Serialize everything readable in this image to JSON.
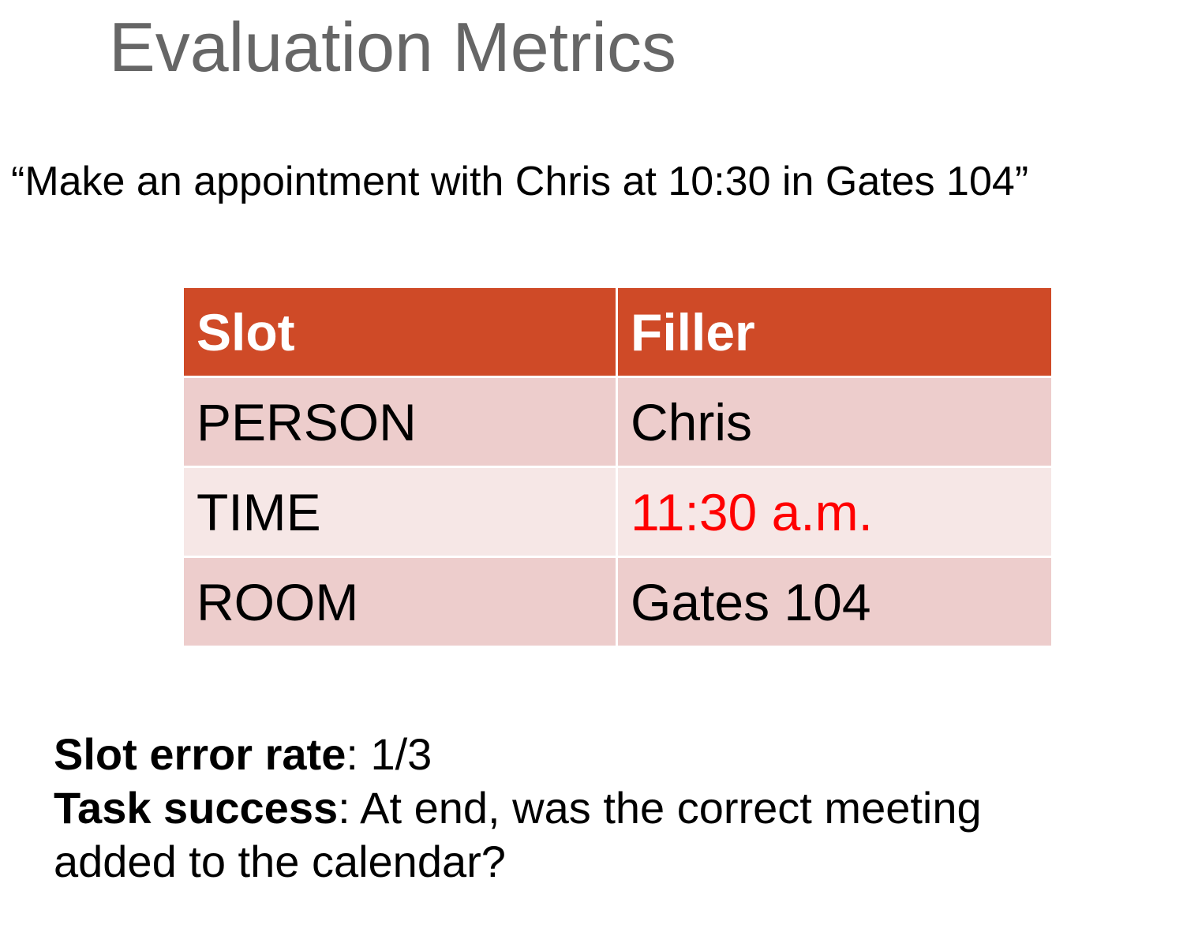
{
  "slide": {
    "title": "Evaluation Metrics",
    "quote": "“Make an appointment with Chris at 10:30 in Gates 104”"
  },
  "table": {
    "headers": [
      "Slot",
      "Filler"
    ],
    "rows": [
      {
        "slot": "PERSON",
        "filler": "Chris"
      },
      {
        "slot": "TIME",
        "filler": "11:30 a.m.",
        "filler_color": "#ff0000"
      },
      {
        "slot": "ROOM",
        "filler": "Gates 104"
      }
    ],
    "header_color": "#cf4a27"
  },
  "metrics": {
    "slot_error_label": "Slot error rate",
    "slot_error_value": ": 1/3",
    "task_success_label": "Task success",
    "task_success_text_line1": ": At end, was the correct meeting",
    "task_success_text_line2": "added to the calendar?"
  }
}
